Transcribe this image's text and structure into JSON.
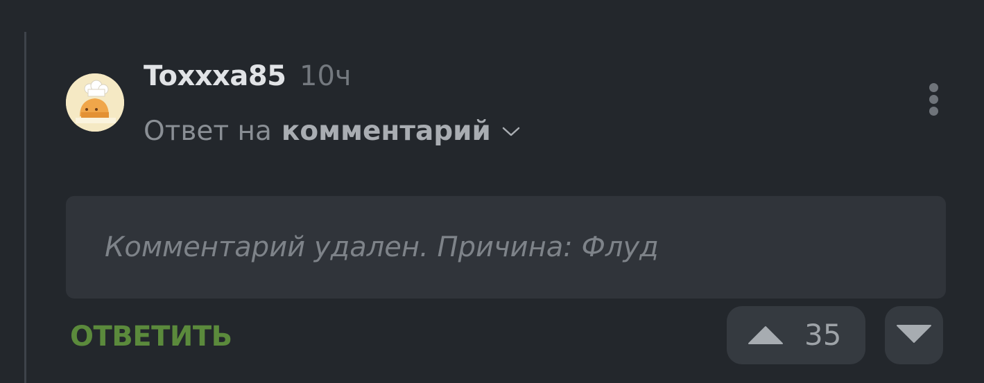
{
  "comment": {
    "author": "Toxxxa85",
    "time": "10ч",
    "reply_prefix": "Ответ на",
    "reply_link": "комментарий",
    "deleted_message": "Комментарий удален. Причина: Флуд",
    "reply_button_label": "ОТВЕТИТЬ",
    "rating": "35"
  },
  "icons": {
    "avatar": "chef-hat-cat-avatar",
    "reply_dropdown": "chevron-down-icon",
    "menu": "more-vertical-icon",
    "upvote": "triangle-up-icon",
    "downvote": "triangle-down-icon"
  },
  "colors": {
    "background": "#23272c",
    "author": "#e1e3e6",
    "muted": "#74797f",
    "deleted_box": "#30343a",
    "reply_button": "#5b8a3c",
    "vote_button": "#353a40"
  }
}
